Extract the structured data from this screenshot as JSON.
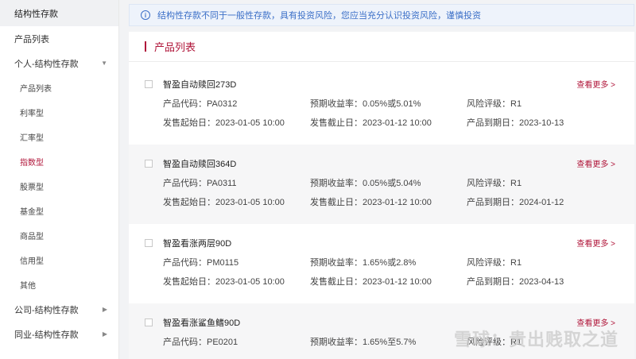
{
  "sidebar": {
    "header": "结构性存款",
    "product_list": "产品列表",
    "groups": [
      {
        "label": "个人-结构性存款",
        "caret": "▼"
      },
      {
        "label": "公司-结构性存款",
        "caret": "▶"
      },
      {
        "label": "同业-结构性存款",
        "caret": "▶"
      }
    ],
    "sub_items": [
      "产品列表",
      "利率型",
      "汇率型",
      "指数型",
      "股票型",
      "基金型",
      "商品型",
      "信用型",
      "其他"
    ],
    "active_sub": "指数型"
  },
  "notice": {
    "icon": "info-icon",
    "text": "结构性存款不同于一般性存款，具有投资风险，您应当充分认识投资风险，谨慎投资"
  },
  "panel": {
    "title": "产品列表"
  },
  "products": [
    {
      "name": "智盈自动赎回273D",
      "more": "查看更多 >",
      "code": "产品代码：PA0312",
      "yield": "预期收益率：0.05%或5.01%",
      "risk": "风险评级：R1",
      "start": "发售起始日：2023-01-05 10:00",
      "end": "发售截止日：2023-01-12 10:00",
      "maturity": "产品到期日：2023-10-13"
    },
    {
      "name": "智盈自动赎回364D",
      "more": "查看更多 >",
      "code": "产品代码：PA0311",
      "yield": "预期收益率：0.05%或5.04%",
      "risk": "风险评级：R1",
      "start": "发售起始日：2023-01-05 10:00",
      "end": "发售截止日：2023-01-12 10:00",
      "maturity": "产品到期日：2024-01-12"
    },
    {
      "name": "智盈看涨两层90D",
      "more": "查看更多 >",
      "code": "产品代码：PM0115",
      "yield": "预期收益率：1.65%或2.8%",
      "risk": "风险评级：R1",
      "start": "发售起始日：2023-01-05 10:00",
      "end": "发售截止日：2023-01-12 10:00",
      "maturity": "产品到期日：2023-04-13"
    },
    {
      "name": "智盈看涨鲨鱼鳍90D",
      "more": "查看更多 >",
      "code": "产品代码：PE0201",
      "yield": "预期收益率：1.65%至5.7%",
      "risk": "风险评级：R1"
    }
  ],
  "watermark": "雪球：贵出贱取之道",
  "colors": {
    "accent": "#b0163a",
    "notice": "#3b6fc7"
  }
}
